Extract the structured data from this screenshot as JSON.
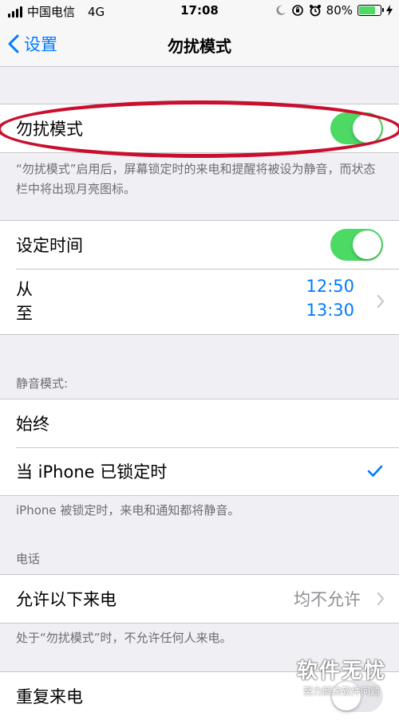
{
  "status_bar": {
    "carrier": "中国电信",
    "network": "4G",
    "time": "17:08",
    "battery": "80%",
    "battery_level": 0.8
  },
  "nav": {
    "back_label": "设置",
    "title": "勿扰模式"
  },
  "dnd": {
    "label": "勿扰模式",
    "enabled": true,
    "note": "“勿扰模式”启用后，屏幕锁定时的来电和提醒将被设为静音，而状态栏中将出现月亮图标。"
  },
  "scheduled": {
    "label": "设定时间",
    "enabled": true,
    "from_label": "从",
    "to_label": "至",
    "from_time": "12:50",
    "to_time": "13:30"
  },
  "silence": {
    "header": "静音模式:",
    "options": [
      {
        "label": "始终",
        "checked": false
      },
      {
        "label": "当 iPhone 已锁定时",
        "checked": true
      }
    ],
    "note": "iPhone 被锁定时，来电和通知都将静音。"
  },
  "phone": {
    "header": "电话",
    "allow_label": "允许以下来电",
    "allow_value": "均不允许",
    "note": "处于“勿扰模式”时，不允许任何人来电。",
    "repeat_label": "重复来电"
  },
  "watermark": {
    "main": "软件无忧",
    "sub": "努力解决软件问题"
  },
  "colors": {
    "accent": "#007aff",
    "toggle_on": "#4cd964",
    "highlight": "#c8102e"
  }
}
